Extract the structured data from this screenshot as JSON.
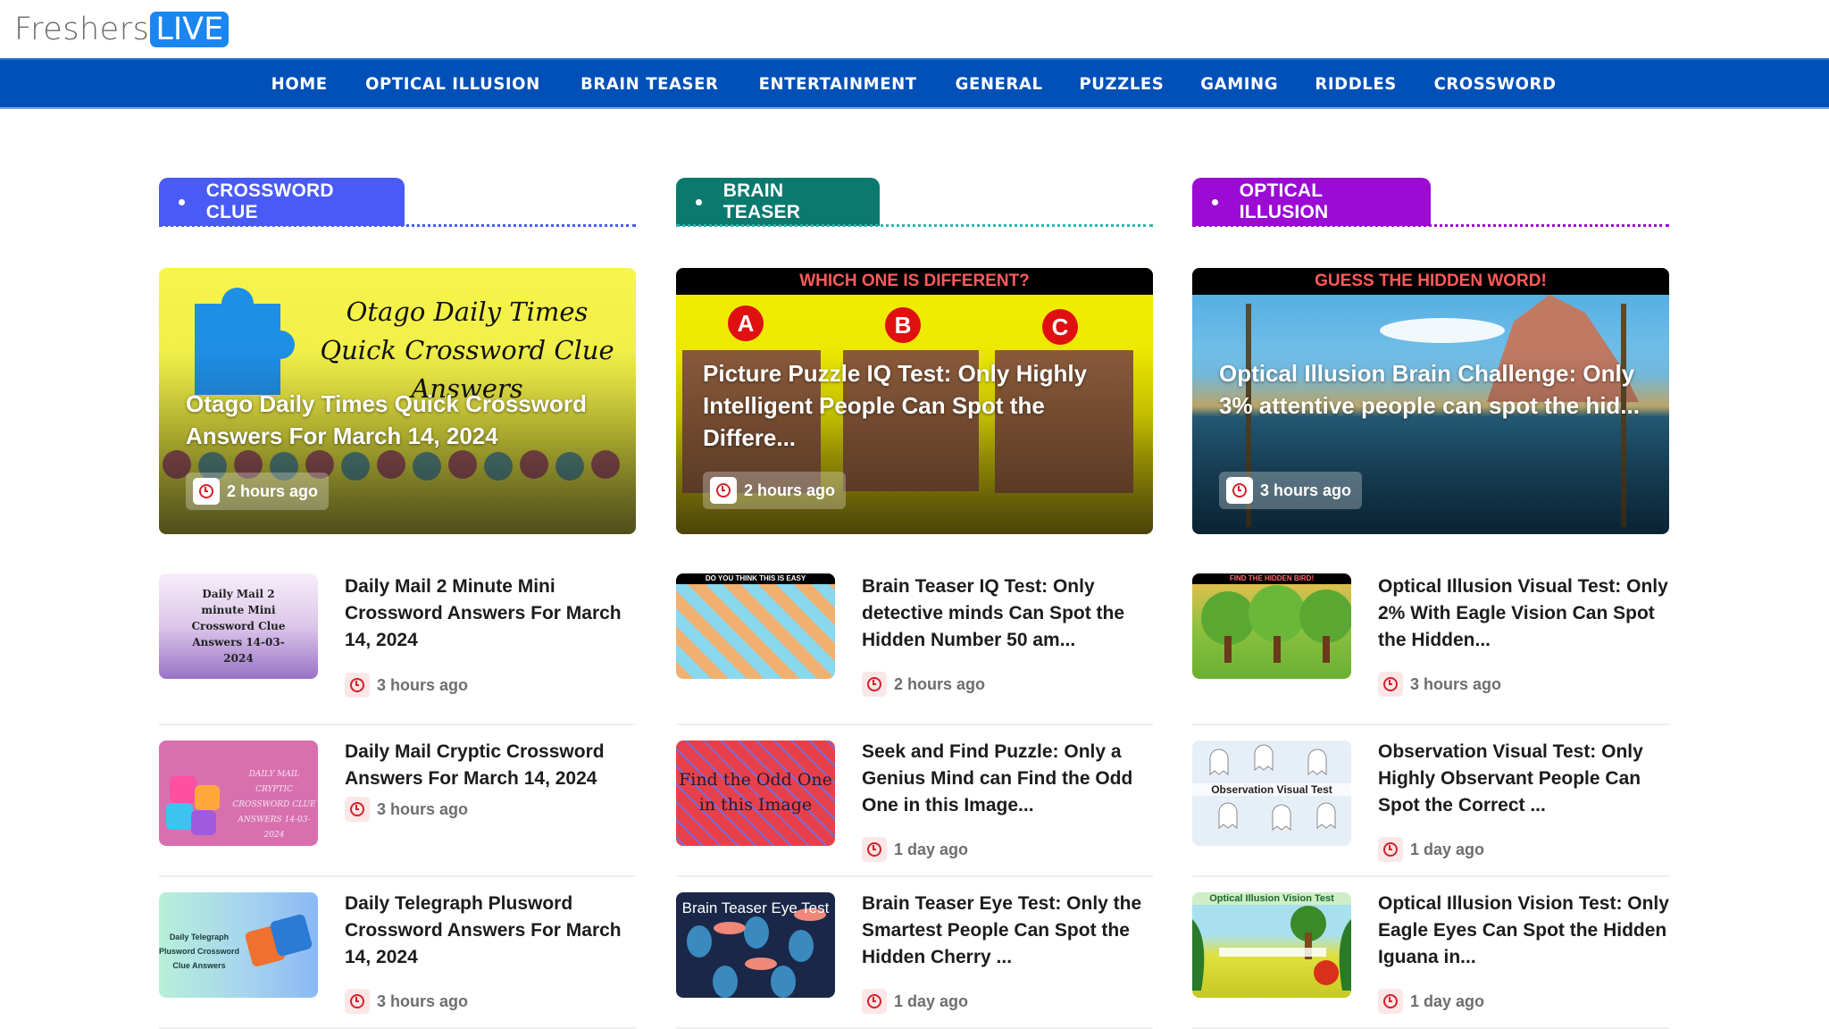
{
  "site": {
    "logo_part1": "Freshers",
    "logo_part2": "LIVE"
  },
  "nav": [
    {
      "label": "HOME"
    },
    {
      "label": "OPTICAL ILLUSION"
    },
    {
      "label": "BRAIN TEASER"
    },
    {
      "label": "ENTERTAINMENT"
    },
    {
      "label": "GENERAL"
    },
    {
      "label": "PUZZLES"
    },
    {
      "label": "GAMING"
    },
    {
      "label": "RIDDLES"
    },
    {
      "label": "CROSSWORD"
    }
  ],
  "colors": {
    "nav_bg": "#0050b8",
    "crossword": "#4a5af5",
    "brain_teaser": "#0b7a6e",
    "optical_illusion": "#9b0bd4",
    "clock": "#d6202a"
  },
  "sections": [
    {
      "heading": "CROSSWORD CLUE",
      "featured": {
        "title": "Otago Daily Times Quick Crossword Answers For March 14, 2024",
        "time": "2 hours ago",
        "image_caption": "Otago Daily Times Quick Crossword Clue Answers"
      },
      "items": [
        {
          "title": "Daily Mail 2 Minute Mini Crossword Answers For March 14, 2024",
          "time": "3 hours ago",
          "thumb_caption": "Daily Mail 2 minute Mini Crossword Clue Answers 14-03-2024"
        },
        {
          "title": "Daily Mail Cryptic Crossword Answers For March 14, 2024",
          "time": "3 hours ago",
          "thumb_caption": "DAILY MAIL CRYPTIC CROSSWORD CLUE ANSWERS 14-03-2024"
        },
        {
          "title": "Daily Telegraph Plusword Crossword Answers For March 14, 2024",
          "time": "3 hours ago",
          "thumb_caption": "Daily Telegraph Plusword Crossword Clue Answers"
        }
      ]
    },
    {
      "heading": "BRAIN TEASER",
      "featured": {
        "title": "Picture Puzzle IQ Test: Only Highly Intelligent People Can Spot the Differe...",
        "time": "2 hours ago",
        "image_caption": "WHICH ONE IS DIFFERENT?",
        "image_labels": [
          "A",
          "B",
          "C"
        ]
      },
      "items": [
        {
          "title": "Brain Teaser IQ Test: Only detective minds Can Spot the Hidden Number 50 am...",
          "time": "2 hours ago",
          "thumb_caption": "DO YOU THINK THIS IS EASY"
        },
        {
          "title": "Seek and Find Puzzle: Only a Genius Mind can Find the Odd One in this Image...",
          "time": "1 day ago",
          "thumb_caption": "Find the Odd One in this Image"
        },
        {
          "title": "Brain Teaser Eye Test: Only the Smartest People Can Spot the Hidden Cherry ...",
          "time": "1 day ago",
          "thumb_caption": "Brain Teaser Eye Test"
        }
      ]
    },
    {
      "heading": "OPTICAL ILLUSION",
      "featured": {
        "title": "Optical Illusion Brain Challenge: Only 3% attentive people can spot the hid...",
        "time": "3 hours ago",
        "image_caption": "GUESS THE HIDDEN WORD!"
      },
      "items": [
        {
          "title": "Optical Illusion Visual Test: Only 2% With Eagle Vision Can Spot the Hidden...",
          "time": "3 hours ago",
          "thumb_caption": "FIND THE HIDDEN BIRD!"
        },
        {
          "title": "Observation Visual Test: Only Highly Observant People Can Spot the Correct ...",
          "time": "1 day ago",
          "thumb_caption": "Observation Visual Test"
        },
        {
          "title": "Optical Illusion Vision Test: Only Eagle Eyes Can Spot the Hidden Iguana in...",
          "time": "1 day ago",
          "thumb_caption": "Optical Illusion Vision Test"
        }
      ]
    }
  ]
}
